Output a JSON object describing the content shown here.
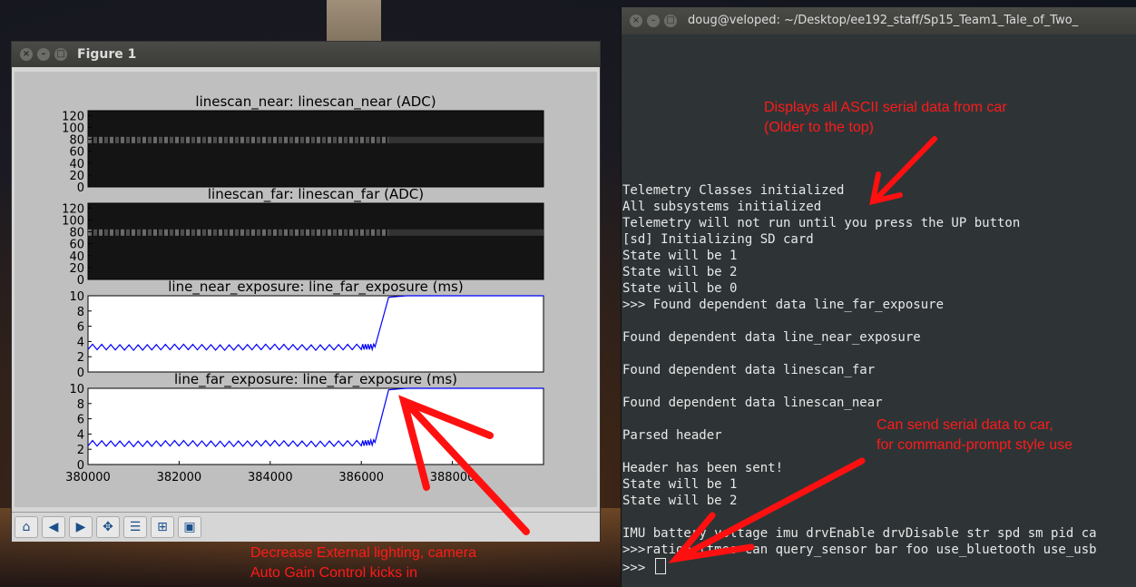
{
  "figure_window": {
    "title": "Figure 1",
    "toolbar_icons": [
      "home-icon",
      "back-icon",
      "forward-icon",
      "pan-icon",
      "subplot-config-icon",
      "zoom-rect-icon",
      "save-icon"
    ]
  },
  "chart_data": [
    {
      "type": "heatmap",
      "title": "linescan_near: linescan_near (ADC)",
      "yticks": [
        "0",
        "20",
        "40",
        "60",
        "80",
        "100",
        "120"
      ],
      "ylim": [
        0,
        128
      ],
      "bright_band_y": 78,
      "band_fades_after_x": 386600
    },
    {
      "type": "heatmap",
      "title": "linescan_far: linescan_far (ADC)",
      "yticks": [
        "0",
        "20",
        "40",
        "60",
        "80",
        "100",
        "120"
      ],
      "ylim": [
        0,
        128
      ],
      "bright_band_y": 78,
      "band_fades_after_x": 386600
    },
    {
      "type": "line",
      "title": "line_near_exposure: line_far_exposure (ms)",
      "yticks": [
        "0",
        "2",
        "4",
        "6",
        "8",
        "10"
      ],
      "ylim": [
        0,
        10
      ],
      "color": "#0000ff",
      "x": [
        380000,
        381000,
        382000,
        383000,
        384000,
        385000,
        386000,
        386300,
        386600,
        387000,
        388000,
        389000,
        390000
      ],
      "y": [
        3.3,
        3.2,
        3.3,
        3.2,
        3.3,
        3.2,
        3.3,
        3.3,
        9.8,
        10,
        10,
        10,
        10
      ]
    },
    {
      "type": "line",
      "title": "line_far_exposure: line_far_exposure (ms)",
      "yticks": [
        "0",
        "2",
        "4",
        "6",
        "8",
        "10"
      ],
      "xticks": [
        "380000",
        "382000",
        "384000",
        "386000",
        "388000"
      ],
      "xlim": [
        380000,
        390000
      ],
      "ylim": [
        0,
        10
      ],
      "color": "#0000ff",
      "x": [
        380000,
        381000,
        382000,
        383000,
        384000,
        385000,
        386000,
        386300,
        386600,
        387000,
        388000,
        389000,
        390000
      ],
      "y": [
        2.8,
        2.7,
        2.8,
        2.7,
        2.8,
        2.7,
        2.8,
        2.9,
        9.8,
        10,
        10,
        10,
        10
      ]
    }
  ],
  "terminal": {
    "title": "doug@veloped: ~/Desktop/ee192_staff/Sp15_Team1_Tale_of_Two_",
    "lines": [
      "Telemetry Classes initialized",
      "All subsystems initialized",
      "Telemetry will not run until you press the UP button",
      "[sd] Initializing SD card",
      "State will be 1",
      "State will be 2",
      "State will be 0",
      ">>> Found dependent data line_far_exposure",
      "",
      "Found dependent data line_near_exposure",
      "",
      "Found dependent data linescan_far",
      "",
      "Found dependent data linescan_near",
      "",
      "Parsed header",
      "",
      "Header has been sent!",
      "State will be 1",
      "State will be 2",
      "",
      "IMU battery voltage imu drvEnable drvDisable str spd sm pid ca",
      ">>>ration ttmes can query_sensor bar foo use_bluetooth use_usb"
    ],
    "prompt": ">>> "
  },
  "annotations": {
    "serial_line1": "Displays all ASCII serial data from car",
    "serial_line2": "(Older to the top)",
    "send_line1": "Can send serial data to car,",
    "send_line2": "for command-prompt style use",
    "lighting_line1": "Decrease External lighting, camera",
    "lighting_line2": "Auto Gain Control kicks in",
    "color": "#ff1a1a"
  }
}
